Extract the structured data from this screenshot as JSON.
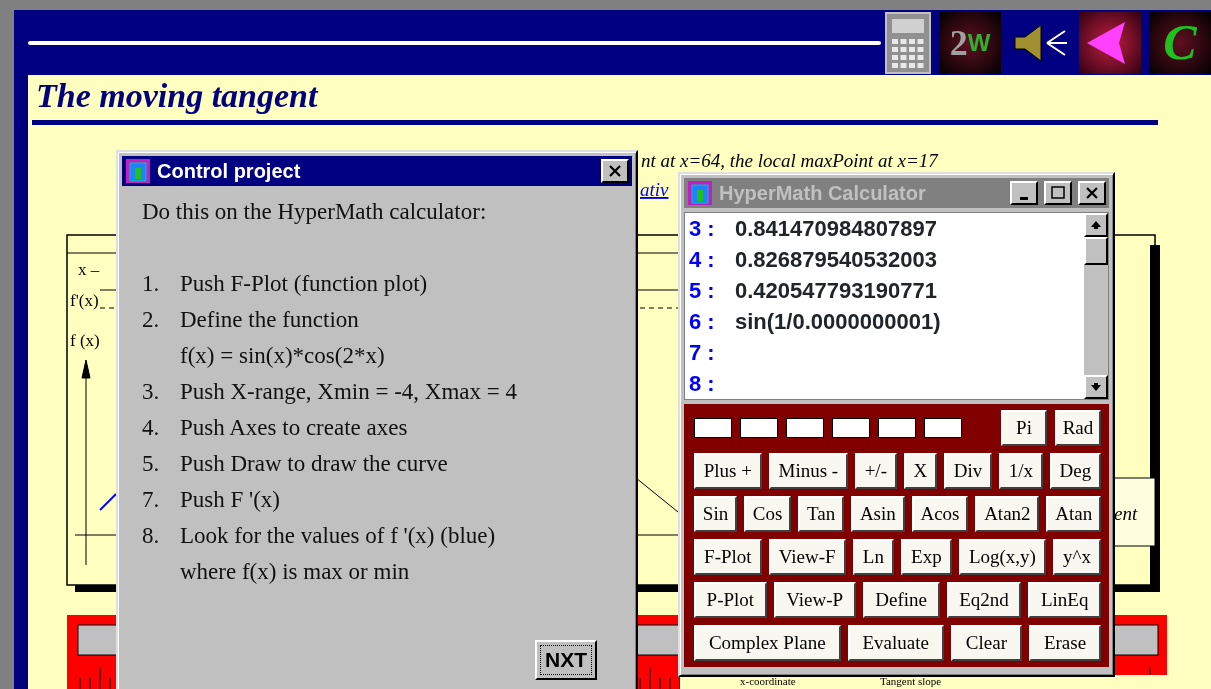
{
  "toolbar_icons": [
    {
      "kind": "calculator"
    },
    {
      "kind": "logo",
      "text": "2",
      "overlay": "W"
    },
    {
      "kind": "speaker"
    },
    {
      "kind": "arrow"
    },
    {
      "kind": "logo",
      "text": "C"
    }
  ],
  "page": {
    "title": "The moving tangent",
    "note": "nt at x=64, the local maxPoint at x=17",
    "link": "ativ",
    "graph_labels": [
      "x –",
      "f'(x)",
      "f (x)"
    ],
    "side_button": "ent",
    "footer": [
      "x-coordinate",
      "Tangent slope"
    ]
  },
  "control_window": {
    "title": "Control project",
    "active": true,
    "intro": "Do this on the HyperMath calculator:",
    "steps": [
      {
        "number": "1.",
        "lines": [
          "Push F-Plot (function plot)"
        ]
      },
      {
        "number": "2.",
        "lines": [
          "Define the function",
          "f(x) = sin(x)*cos(2*x)"
        ]
      },
      {
        "number": "3.",
        "lines": [
          "Push X-range, Xmin = -4, Xmax = 4"
        ]
      },
      {
        "number": "4.",
        "lines": [
          "Push Axes to create axes"
        ]
      },
      {
        "number": "5.",
        "lines": [
          "Push Draw to draw the curve"
        ]
      },
      {
        "number": "7.",
        "lines": [
          "Push F '(x)"
        ]
      },
      {
        "number": "8.",
        "lines": [
          "Look for the values of  f '(x) (blue)",
          "where f(x) is max or min"
        ]
      }
    ],
    "button": "NXT"
  },
  "calculator": {
    "title": "HyperMath Calculator",
    "active": false,
    "lines": [
      {
        "number": "3 :",
        "value": "0.841470984807897"
      },
      {
        "number": "4 :",
        "value": "0.826879540532003"
      },
      {
        "number": "5 :",
        "value": "0.420547793190771"
      },
      {
        "number": "6 :",
        "value": "sin(1/0.0000000001)"
      },
      {
        "number": "7 :"
      },
      {
        "number": "8 :"
      }
    ],
    "top_keys": [
      "Pi",
      "Rad"
    ],
    "key_rows": [
      [
        "Plus +",
        "Minus -",
        "+/-",
        "X",
        "Div",
        "1/x",
        "Deg"
      ],
      [
        "Sin",
        "Cos",
        "Tan",
        "Asin",
        "Acos",
        "Atan2",
        "Atan"
      ],
      [
        "F-Plot",
        "View-F",
        "Ln",
        "Exp",
        "Log(x,y)",
        "y^x"
      ],
      [
        "P-Plot",
        "View-P",
        "Define",
        "Eq2nd",
        "LinEq"
      ],
      [
        "Complex Plane",
        "Evaluate",
        "Clear",
        "Erase"
      ]
    ]
  }
}
